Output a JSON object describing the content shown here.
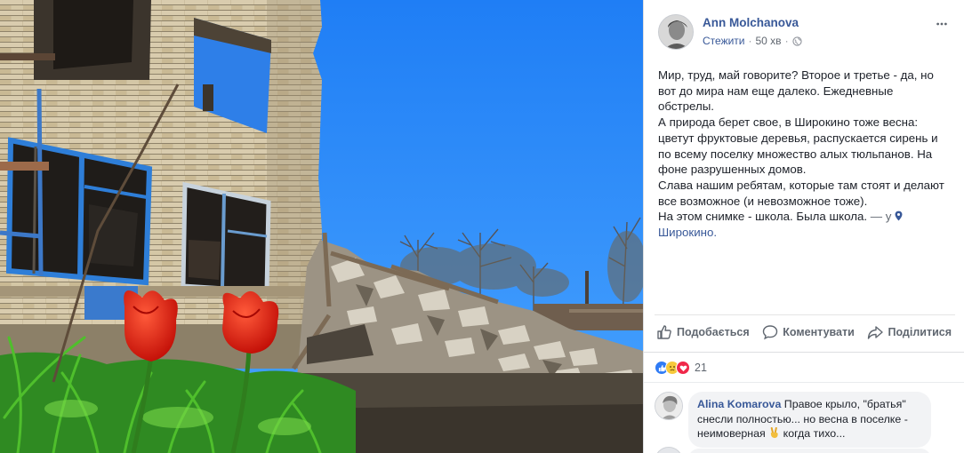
{
  "post": {
    "author": "Ann Molchanova",
    "follow": "Стежити",
    "time": "50 хв",
    "lines": [
      "Мир, труд, май говорите? Второе и третье - да, но вот до мира нам еще далеко. Ежедневные обстрелы.",
      "А природа берет свое, в Широкино тоже весна: цветут фруктовые деревья, распускается сирень и по всему поселку множество алых тюльпанов. На фоне разрушенных домов.",
      "Слава нашим ребятам, которые там стоят и делают все возможное (и невозможное тоже).",
      "На этом снимке - школа. Была школа."
    ],
    "location_prefix": " — у ",
    "location": "Широкино."
  },
  "actions": {
    "share": "Поділитися",
    "like": "Подобається",
    "comment": "Коментувати"
  },
  "reactions": {
    "icons": [
      "like-reaction",
      "sad-reaction",
      "love-reaction"
    ],
    "count": "21"
  },
  "comments": [
    {
      "author": "Alina Komarova",
      "text_before": " Правое крыло, \"братья\" снесли полностью... но весна в поселке - неимоверная ",
      "emoji": "victory-hand",
      "text_after": " когда тихо..."
    }
  ],
  "colors": {
    "link": "#385898",
    "meta": "#606770",
    "bubble": "#f2f3f5",
    "sky": "#2e8dff",
    "tulip": "#e8120a"
  }
}
